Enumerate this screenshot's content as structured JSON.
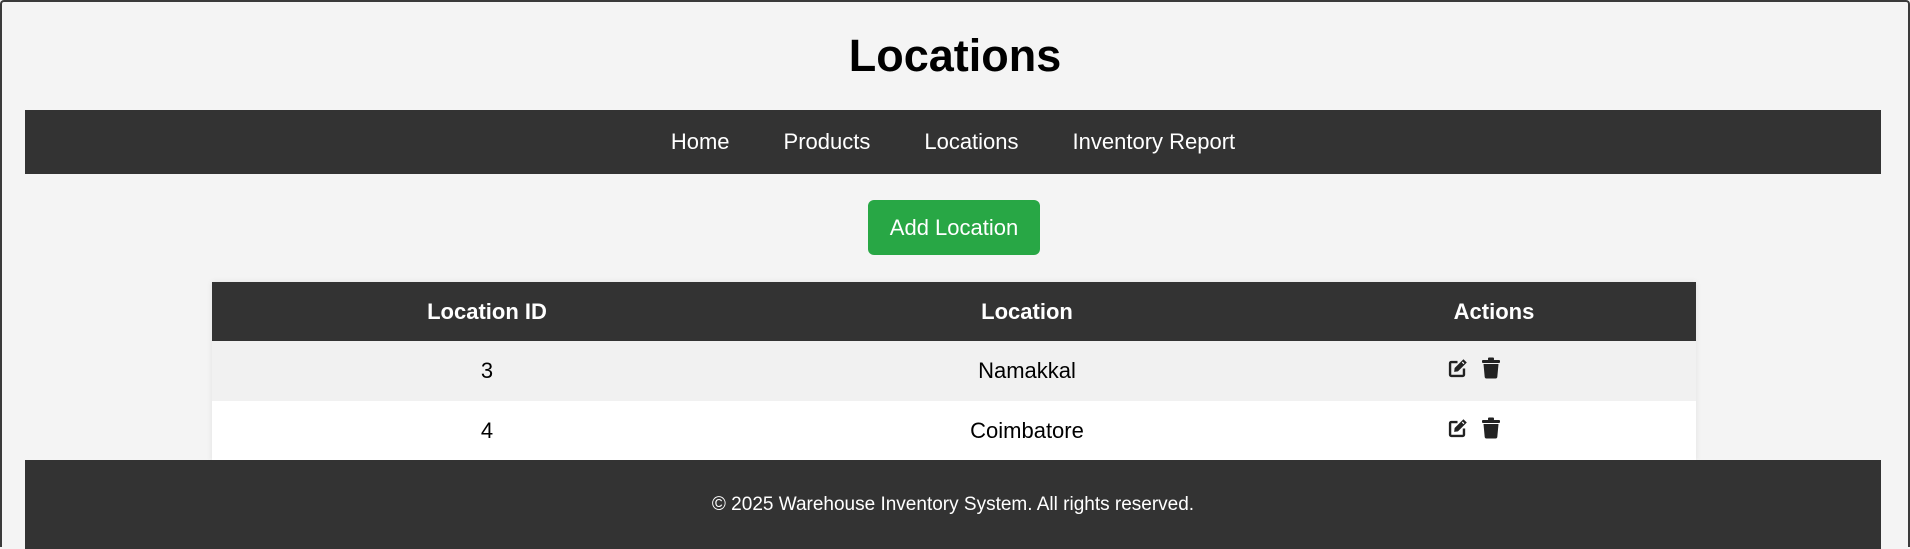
{
  "page": {
    "title": "Locations"
  },
  "nav": {
    "items": [
      {
        "label": "Home"
      },
      {
        "label": "Products"
      },
      {
        "label": "Locations"
      },
      {
        "label": "Inventory Report"
      }
    ]
  },
  "actions": {
    "add_label": "Add Location"
  },
  "table": {
    "columns": [
      "Location ID",
      "Location",
      "Actions"
    ],
    "rows": [
      {
        "id": "3",
        "location": "Namakkal",
        "icons": [
          "edit-icon",
          "trash-icon"
        ]
      },
      {
        "id": "4",
        "location": "Coimbatore",
        "icons": [
          "edit-icon",
          "trash-icon"
        ]
      }
    ]
  },
  "footer": {
    "text": "© 2025 Warehouse Inventory System. All rights reserved."
  },
  "colors": {
    "header_bg": "#333333",
    "add_button": "#28a745",
    "page_bg": "#f4f4f4",
    "icon": "#222222"
  }
}
